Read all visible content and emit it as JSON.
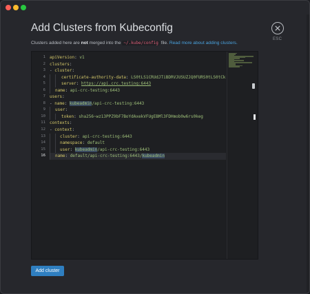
{
  "dialog": {
    "title": "Add Clusters from Kubeconfig",
    "esc_label": "ESC",
    "close_icon": "close-icon"
  },
  "info": {
    "prefix": "Clusters added here are ",
    "bold": "not",
    "middle": " merged into the ",
    "path": "~/.kube/config",
    "suffix": " file. ",
    "link": "Read more about adding clusters."
  },
  "editor": {
    "line_numbers": [
      "1",
      "2",
      "3",
      "4",
      "5",
      "6",
      "7",
      "8",
      "9",
      "10",
      "11",
      "12",
      "13",
      "14",
      "15",
      "16"
    ],
    "active_line": 16
  },
  "code": {
    "l1": {
      "key": "apiVersion",
      "val": "v1"
    },
    "l2": {
      "key": "clusters"
    },
    "l3": {
      "key": "cluster"
    },
    "l4": {
      "key": "certificate-authority-data",
      "val": "LS0tLS1CRUdJTiBDRVJUSUZJQ0FURS0tLS0tCk"
    },
    "l5": {
      "key": "server",
      "val": "https://api.crc.testing:6443"
    },
    "l6": {
      "key": "name",
      "val": "api-crc-testing:6443"
    },
    "l7": {
      "key": "users"
    },
    "l8": {
      "key": "name",
      "hl": "kubeadmin",
      "rest": "/api-crc-testing:6443"
    },
    "l9": {
      "key": "user"
    },
    "l10": {
      "key": "token",
      "val": "sha256~wz13PPZ9bF7BoYdAxekVFUgEBMl3FDHmob0w6rs0keg"
    },
    "l11": {
      "key": "contexts"
    },
    "l12": {
      "key": "context"
    },
    "l13": {
      "key": "cluster",
      "val": "api-crc-testing:6443"
    },
    "l14": {
      "key": "namespace",
      "val": "default"
    },
    "l15": {
      "key": "user",
      "hl": "kubeadmin",
      "rest": "/api-crc-testing:6443"
    },
    "l16": {
      "key": "name",
      "pre": "default/api-crc-testing:6443/",
      "hl": "kubeadmin"
    }
  },
  "actions": {
    "add_cluster": "Add cluster"
  },
  "colors": {
    "accent": "#2f7fc1",
    "yaml_key": "#d5c96a",
    "yaml_value": "#9fc17a",
    "path_highlight": "#e0607a",
    "link": "#4aa3df"
  }
}
